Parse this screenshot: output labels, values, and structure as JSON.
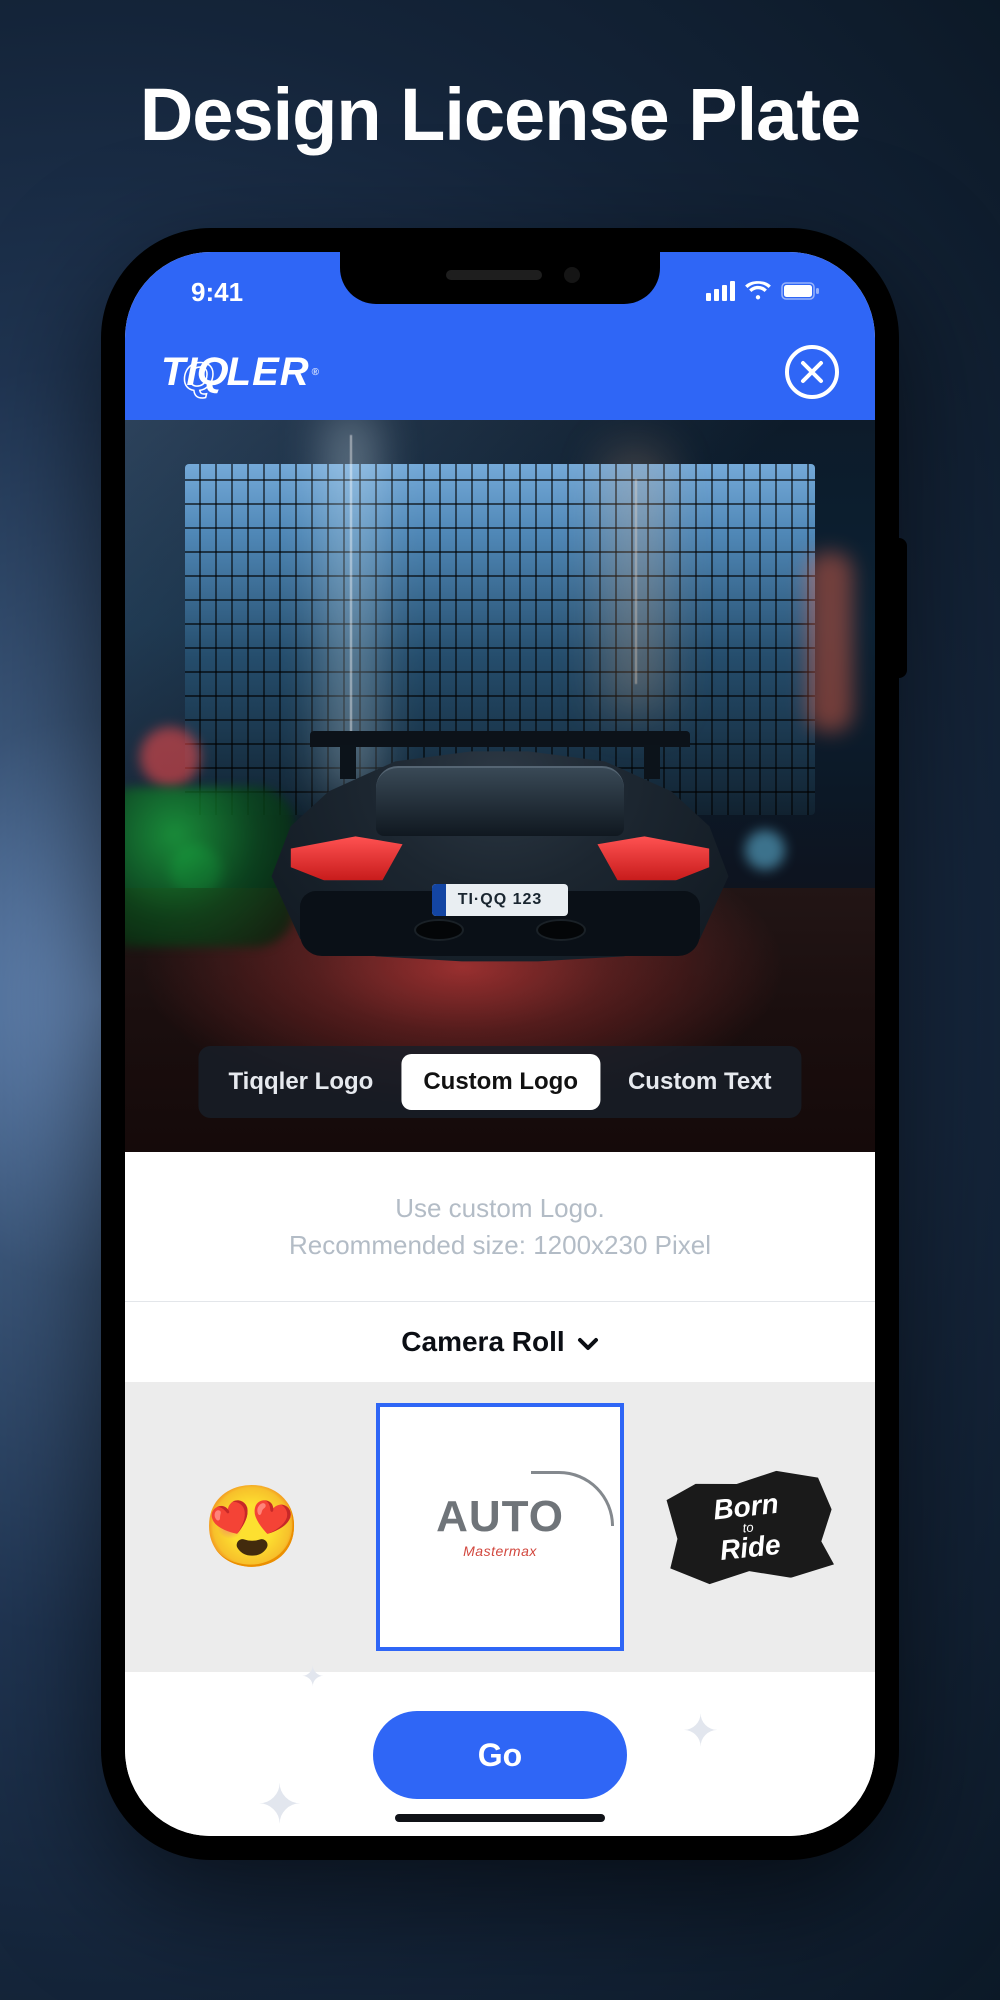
{
  "page_title": "Design License Plate",
  "statusbar": {
    "time": "9:41"
  },
  "header": {
    "brand": "TIQQLER"
  },
  "hero": {
    "plate_text": "TI·QQ 123"
  },
  "segments": {
    "items": [
      "Tiqqler Logo",
      "Custom Logo",
      "Custom Text"
    ],
    "selected_index": 1
  },
  "info": {
    "line1": "Use custom Logo.",
    "line2": "Recommended size: 1200x230 Pixel"
  },
  "source_picker": {
    "label": "Camera Roll"
  },
  "gallery": {
    "selected_index": 1,
    "items": [
      {
        "kind": "emoji",
        "value": "😍"
      },
      {
        "kind": "auto",
        "title": "AUTO",
        "subtitle": "Mastermax"
      },
      {
        "kind": "born",
        "line1": "Born",
        "mid": "to",
        "line2": "Ride"
      }
    ]
  },
  "cta": {
    "label": "Go"
  }
}
